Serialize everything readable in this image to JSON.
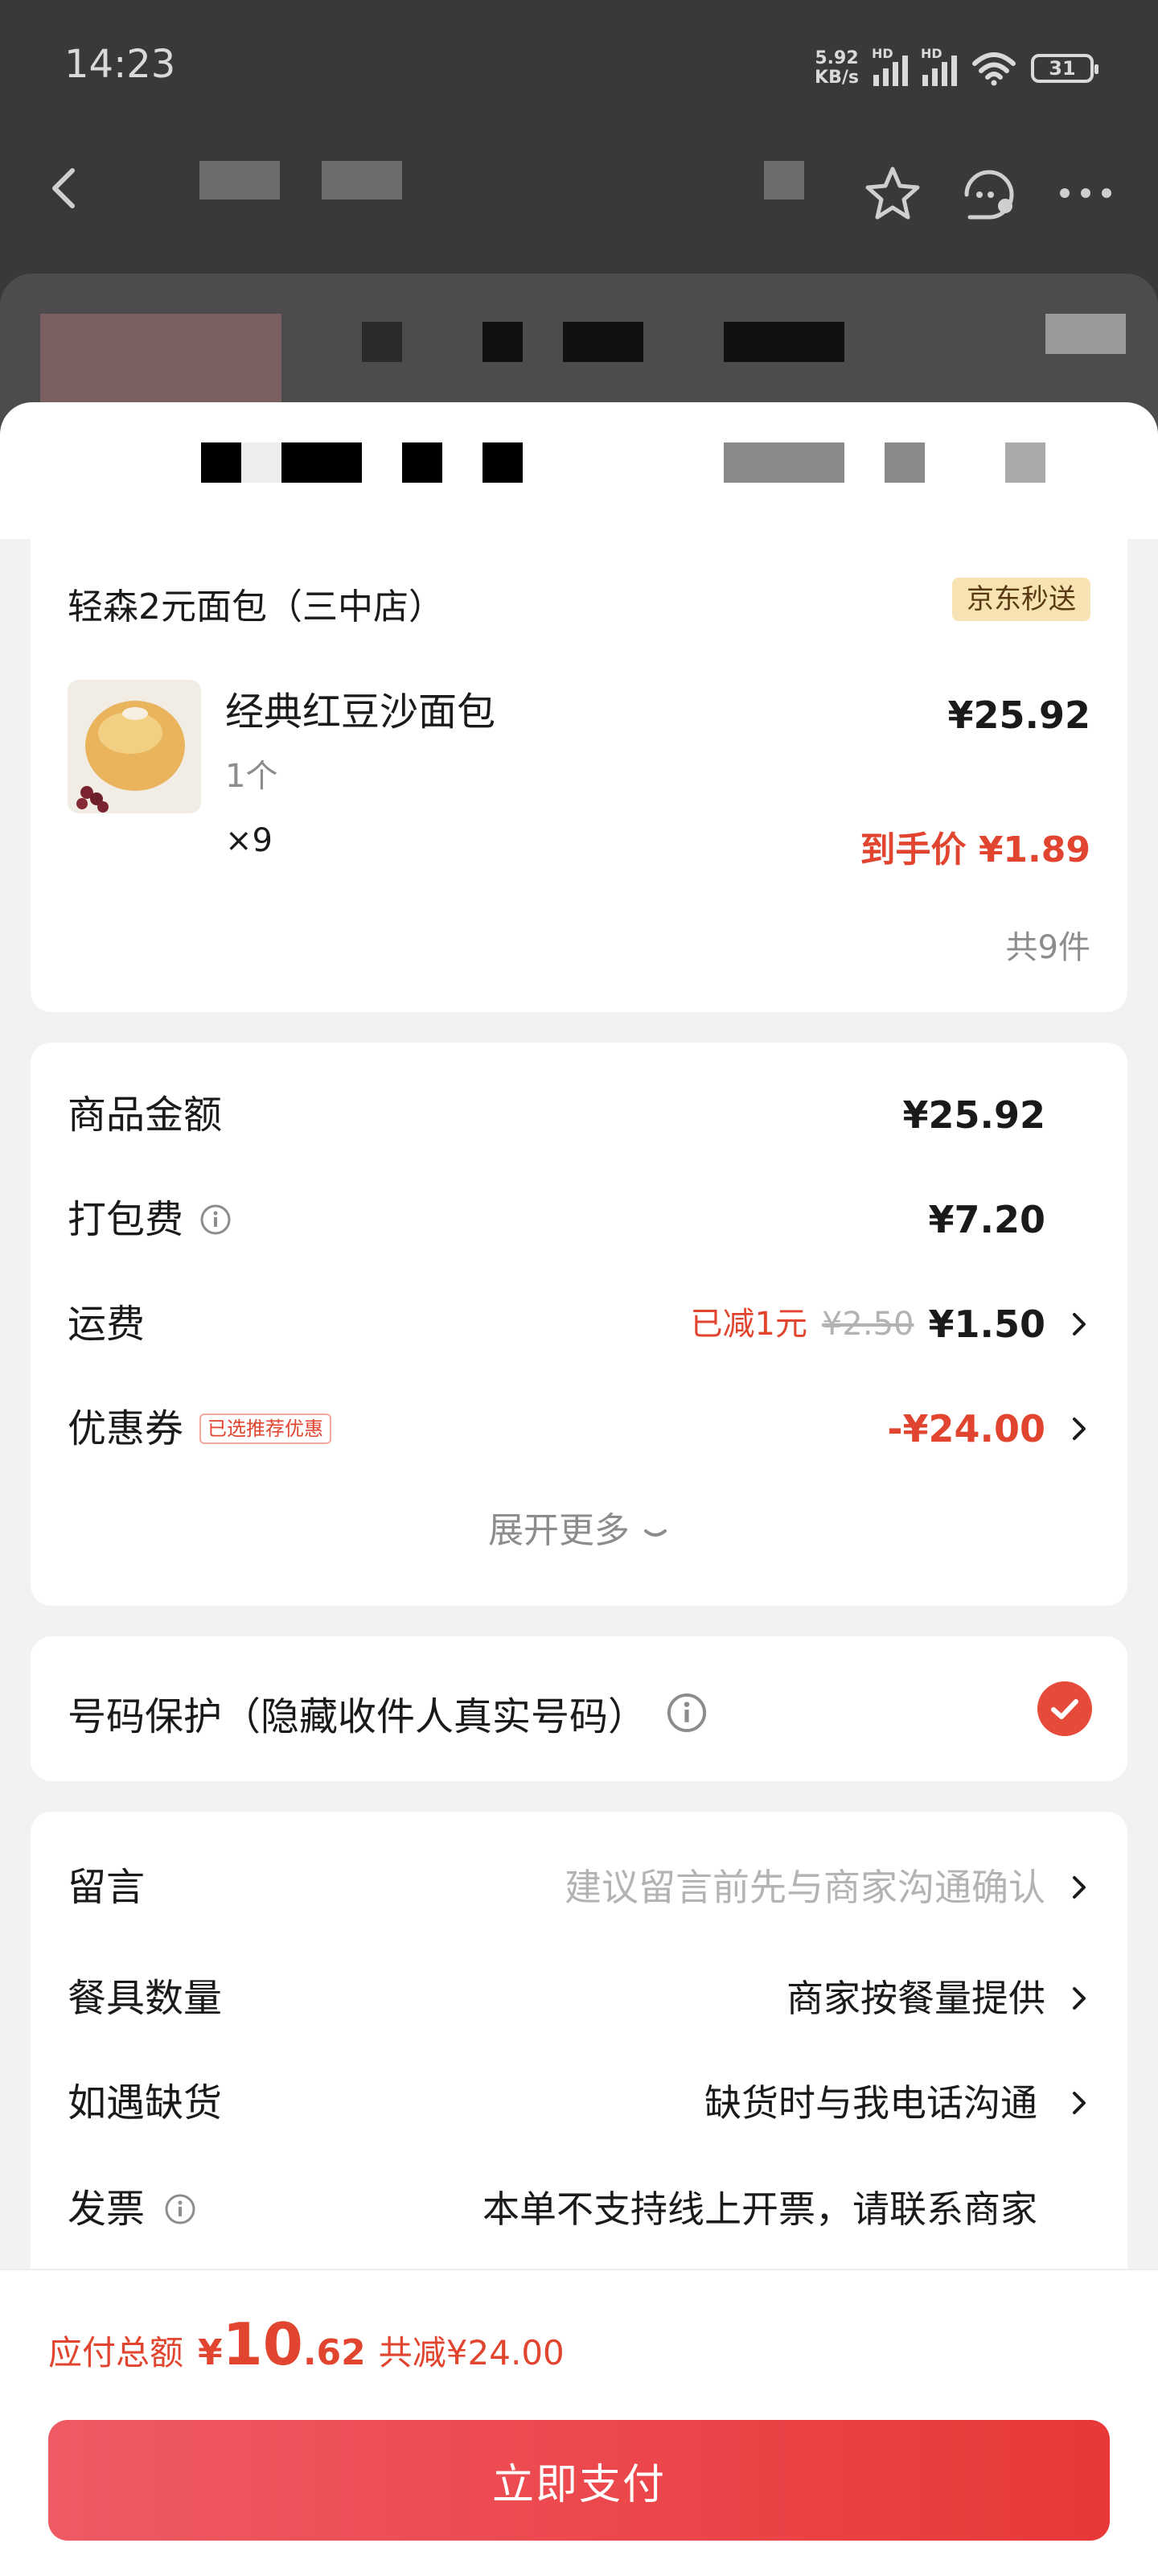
{
  "status_bar": {
    "time": "14:23",
    "net_speed_value": "5.92",
    "net_speed_unit": "KB/s",
    "signal_1_label": "HD",
    "signal_2_label": "HD",
    "battery": "31"
  },
  "store": {
    "name": "轻森2元面包（三中店）",
    "delivery_tag": "京东秒送"
  },
  "product": {
    "name": "经典红豆沙面包",
    "spec": "1个",
    "quantity": "×9",
    "price": "¥25.92",
    "final_price": "到手价 ¥1.89",
    "item_count": "共9件"
  },
  "fees": {
    "goods_label": "商品金额",
    "goods_value": "¥25.92",
    "packing_label": "打包费",
    "packing_value": "¥7.20",
    "shipping_label": "运费",
    "shipping_reduced": "已减1元",
    "shipping_original": "¥2.50",
    "shipping_value": "¥1.50",
    "coupon_label": "优惠券",
    "coupon_tag": "已选推荐优惠",
    "coupon_value": "-¥24.00",
    "expand_more": "展开更多"
  },
  "privacy": {
    "label": "号码保护（隐藏收件人真实号码）",
    "checked": true
  },
  "remarks": {
    "message_label": "留言",
    "message_placeholder": "建议留言前先与商家沟通确认",
    "utensils_label": "餐具数量",
    "utensils_value": "商家按餐量提供",
    "out_of_stock_label": "如遇缺货",
    "out_of_stock_value": "缺货时与我电话沟通",
    "invoice_label": "发票",
    "invoice_value": "本单不支持线上开票，请联系商家"
  },
  "footer": {
    "total_label": "应付总额",
    "currency": "¥",
    "total_integer": "10",
    "total_decimal": ".62",
    "total_saved": "共减¥24.00",
    "pay_button": "立即支付"
  },
  "colors": {
    "accent_red": "#e1452f",
    "button_start": "#ef5a64",
    "button_end": "#e83838",
    "tag_bg": "#f7e2b4"
  }
}
